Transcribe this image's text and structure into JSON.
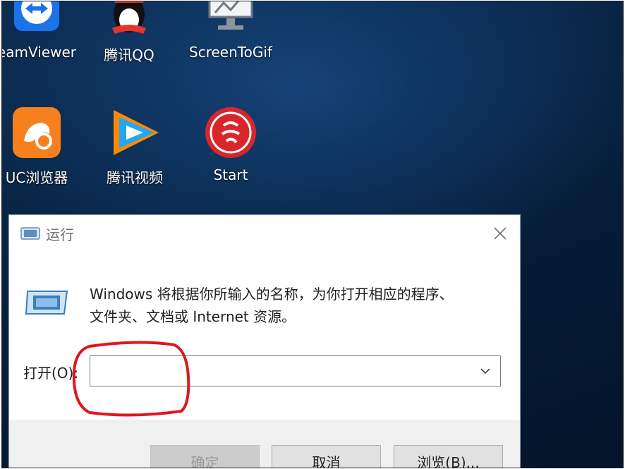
{
  "desktop": {
    "icons": [
      {
        "label": "eamViewer",
        "icon": "teamviewer-icon",
        "color": "#1a73e8"
      },
      {
        "label": "腾讯QQ",
        "icon": "qq-penguin-icon",
        "color": "#e5352a"
      },
      {
        "label": "ScreenToGif",
        "icon": "screentogif-icon",
        "color": "#cfd6dd"
      },
      {
        "label": "UC浏览器",
        "icon": "uc-browser-icon",
        "color": "#f7801e"
      },
      {
        "label": "腾讯视频",
        "icon": "tencent-video-icon",
        "color": "#23a7f2"
      },
      {
        "label": "Start",
        "icon": "start-app-icon",
        "color": "#d9262b"
      }
    ]
  },
  "dialog": {
    "title": "运行",
    "description_line1": "Windows 将根据你所输入的名称，为你打开相应的程序、",
    "description_line2": "文件夹、文档或 Internet 资源。",
    "open_label": "打开(O):",
    "open_value": "",
    "ok_label": "确定",
    "cancel_label": "取消",
    "browse_label": "浏览(B)...",
    "icon": "run-app-icon"
  },
  "annotation": {
    "highlight_color": "#e0161e"
  }
}
